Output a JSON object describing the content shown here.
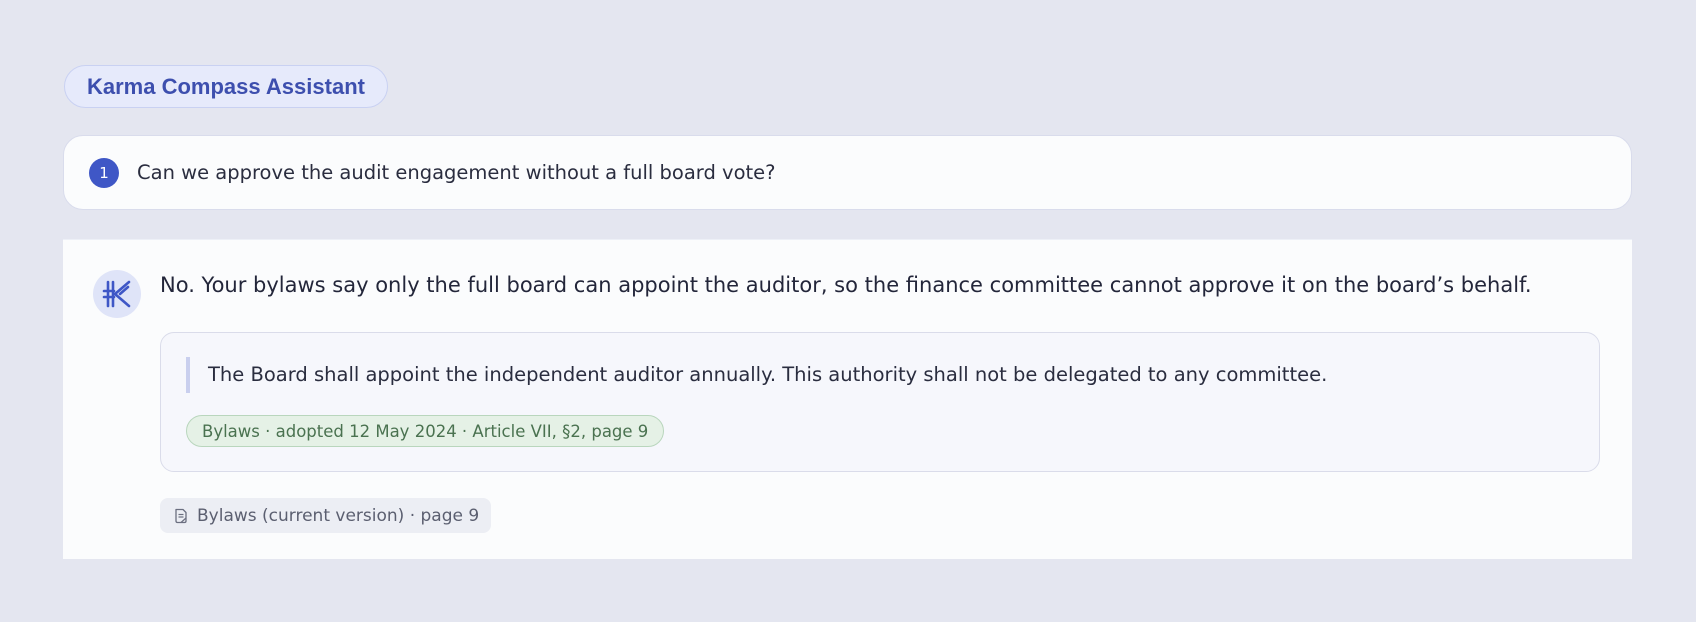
{
  "app": {
    "title": "Karma Compass Assistant"
  },
  "question": {
    "number": "1",
    "text": "Can we approve the audit engagement without a full board vote?"
  },
  "answer": {
    "avatar_icon": "karma-compass-logo",
    "text": "No. Your bylaws say only the full board can appoint the auditor, so the finance committee cannot approve it on the board’s behalf.",
    "quote": {
      "text": "The Board shall appoint the independent auditor annually. This authority shall not be delegated to any committee.",
      "citation": "Bylaws · adopted 12 May 2024 · Article VII, §2, page 9"
    },
    "source": {
      "icon": "document-icon",
      "label": "Bylaws (current version) · page 9"
    }
  },
  "colors": {
    "background": "#e4e6f0",
    "accent": "#3f57c6",
    "citation_green": "#4a7250"
  }
}
